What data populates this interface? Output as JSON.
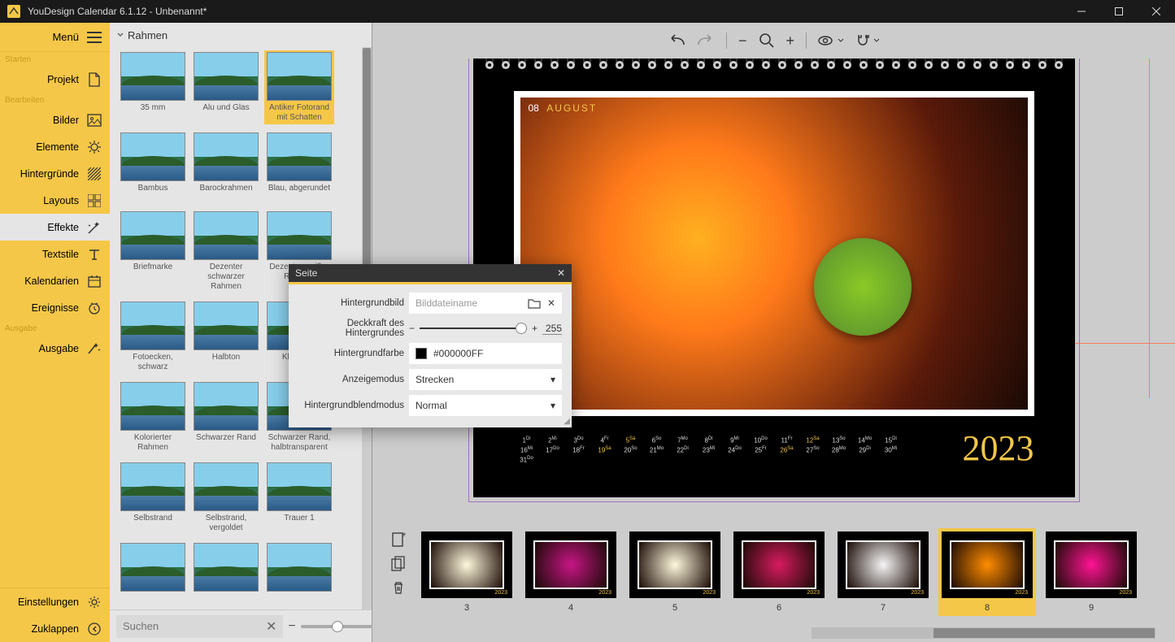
{
  "window": {
    "title": "YouDesign Calendar 6.1.12 - Unbenannt*"
  },
  "sidebar": {
    "menu": "Menü",
    "sections": {
      "starten": "Starten",
      "bearbeiten": "Bearbeiten",
      "ausgabe": "Ausgabe"
    },
    "items": {
      "projekt": "Projekt",
      "bilder": "Bilder",
      "elemente": "Elemente",
      "hintergruende": "Hintergründe",
      "layouts": "Layouts",
      "effekte": "Effekte",
      "textstile": "Textstile",
      "kalendarien": "Kalendarien",
      "ereignisse": "Ereignisse",
      "ausgabe": "Ausgabe",
      "einstellungen": "Einstellungen",
      "zuklappen": "Zuklappen"
    }
  },
  "gallery": {
    "header": "Rahmen",
    "search_placeholder": "Suchen",
    "items": [
      "35 mm",
      "Alu und Glas",
      "Antiker Fotorand mit Schatten",
      "Bambus",
      "Barockrahmen",
      "Blau, abgerundet",
      "Briefmarke",
      "Dezenter schwarzer Rahmen",
      "Dezenter weißer Rahmen",
      "Fotoecken, schwarz",
      "Halbton",
      "Klassisch",
      "Kolorierter Rahmen",
      "Schwarzer Rand",
      "Schwarzer Rand, halbtransparent",
      "Selbstrand",
      "Selbstrand, vergoldet",
      "Trauer 1",
      "",
      "",
      ""
    ],
    "selected_index": 2
  },
  "dialog": {
    "title": "Seite",
    "labels": {
      "hintergrundbild": "Hintergrundbild",
      "deckkraft": "Deckkraft des Hintergrundes",
      "hintergrundfarbe": "Hintergrundfarbe",
      "anzeigemodus": "Anzeigemodus",
      "blendmodus": "Hintergrundblendmodus"
    },
    "values": {
      "bild_placeholder": "Bilddateiname",
      "deckkraft": "255",
      "farbe": "#000000FF",
      "anzeigemodus": "Strecken",
      "blendmodus": "Normal"
    }
  },
  "calendar": {
    "page_num": "08",
    "month": "August",
    "year": "2023",
    "days_row1": [
      "1 Di",
      "2 Mi",
      "3 Do",
      "4 Fr",
      "5 Sa",
      "6 So",
      "7 Mo",
      "8 Di",
      "9 Mi",
      "10 Do",
      "11 Fr",
      "12 Sa",
      "13 So",
      "14 Mo",
      "15 Di",
      "16 Mi"
    ],
    "days_row2": [
      "17 Do",
      "18 Fr",
      "19 Sa",
      "20 So",
      "21 Mo",
      "22 Di",
      "23 Mi",
      "24 Do",
      "25 Fr",
      "26 Sa",
      "27 So",
      "28 Mo",
      "29 Di",
      "30 Mi",
      "31 Do",
      ""
    ]
  },
  "filmstrip": {
    "items": [
      3,
      4,
      5,
      6,
      7,
      8,
      9
    ],
    "selected": 8,
    "year": "2023"
  }
}
